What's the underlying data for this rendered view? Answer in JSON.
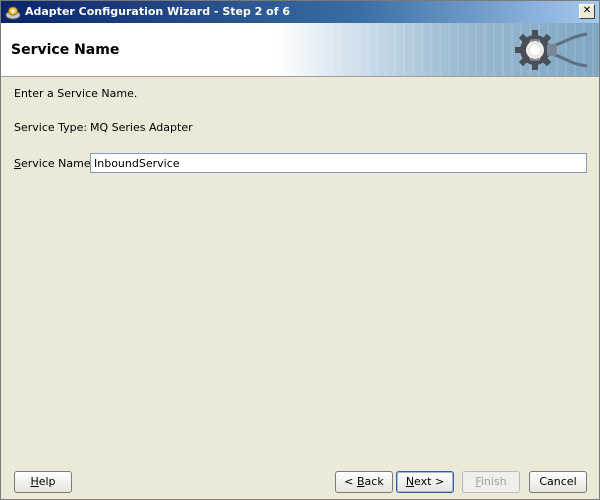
{
  "window": {
    "title": "Adapter Configuration Wizard - Step 2 of 6"
  },
  "header": {
    "title": "Service Name"
  },
  "form": {
    "instruction": "Enter a Service Name.",
    "service_type_label": "Service Type:",
    "service_type_value": "MQ Series Adapter",
    "service_name_label_first": "S",
    "service_name_label_rest": "ervice Name:",
    "service_name_value": "InboundService"
  },
  "buttons": {
    "help_first": "H",
    "help_rest": "elp",
    "back_pre": "< ",
    "back_u": "B",
    "back_rest": "ack",
    "next_u": "N",
    "next_rest": "ext >",
    "finish_u": "F",
    "finish_rest": "inish",
    "cancel": "Cancel"
  },
  "icons": {
    "app": "oracle-app-icon",
    "close": "close-icon",
    "gear": "gear-plug-icon"
  }
}
